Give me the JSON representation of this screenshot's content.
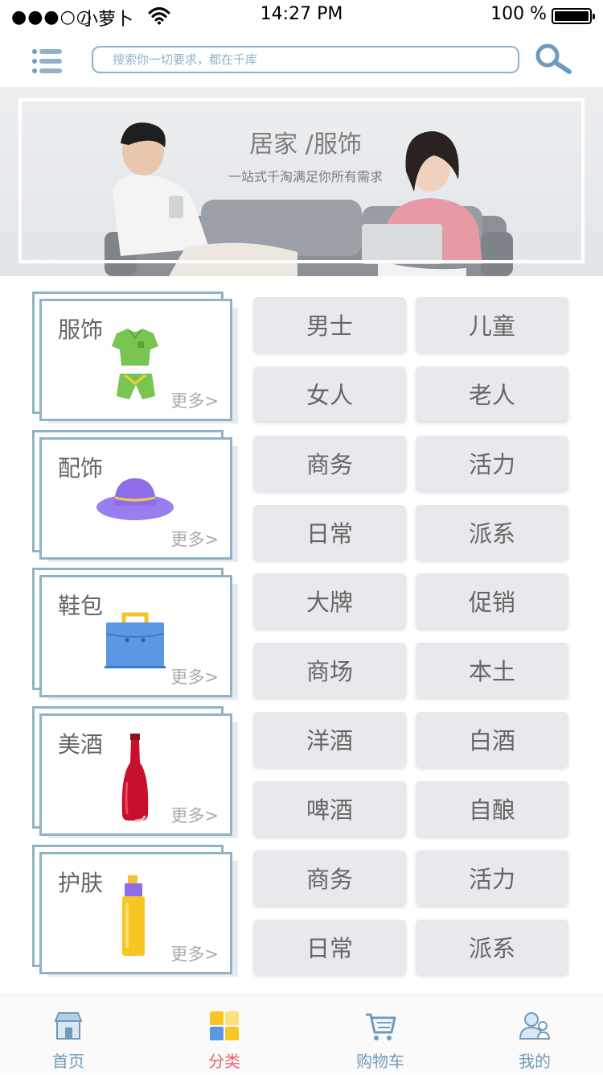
{
  "status_bar": {
    "signal": "●●●○○",
    "carrier": "小萝卜",
    "time": "14:27 PM",
    "battery": "100 %"
  },
  "header": {
    "search_placeholder": "搜索你一切要求，都在千库"
  },
  "banner": {
    "title": "居家 /服饰",
    "subtitle": "一站式千淘满足你所有需求"
  },
  "categories": [
    {
      "title": "服饰",
      "more": "更多>",
      "icon": "clothes-icon",
      "tags": [
        "男士",
        "儿童",
        "女人",
        "老人"
      ]
    },
    {
      "title": "配饰",
      "more": "更多>",
      "icon": "hat-icon",
      "tags": [
        "商务",
        "活力",
        "日常",
        "派系"
      ]
    },
    {
      "title": "鞋包",
      "more": "更多>",
      "icon": "bag-icon",
      "tags": [
        "大牌",
        "促销",
        "商场",
        "本土"
      ]
    },
    {
      "title": "美酒",
      "more": "更多>",
      "icon": "wine-bottle-icon",
      "tags": [
        "洋酒",
        "白酒",
        "啤酒",
        "自酿"
      ]
    },
    {
      "title": "护肤",
      "more": "更多>",
      "icon": "skincare-bottle-icon",
      "tags": [
        "商务",
        "活力",
        "日常",
        "派系"
      ]
    }
  ],
  "bottom_nav": [
    {
      "label": "首页",
      "icon": "home-icon",
      "active": false
    },
    {
      "label": "分类",
      "icon": "category-icon",
      "active": true
    },
    {
      "label": "购物车",
      "icon": "cart-icon",
      "active": false
    },
    {
      "label": "我的",
      "icon": "user-icon",
      "active": false
    }
  ],
  "colors": {
    "accent": "#8fb2c9",
    "active_tab": "#e8666a",
    "nav_text": "#6e9bbd",
    "chip_bg": "#e7e9ec"
  }
}
